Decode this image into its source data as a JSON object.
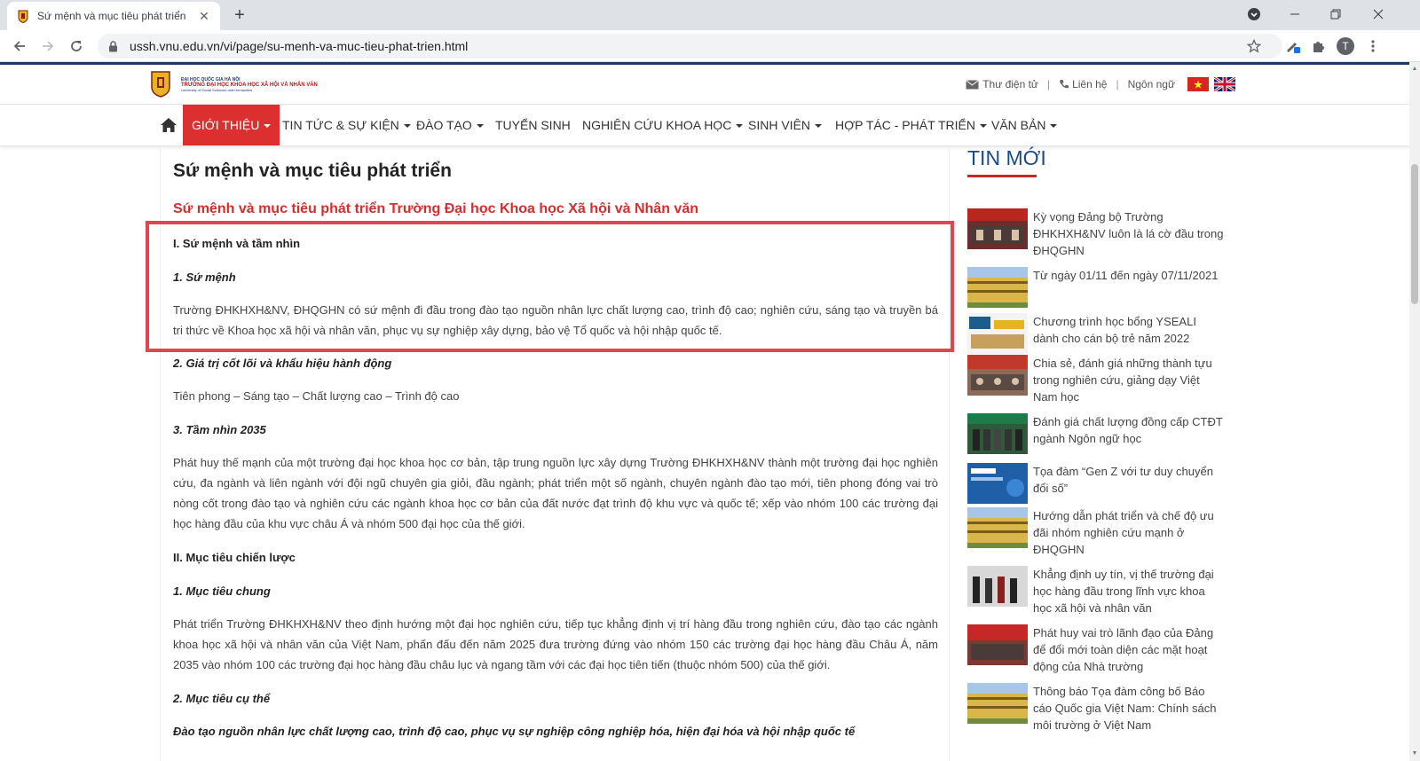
{
  "browser": {
    "tab_title": "Sứ mệnh và mục tiêu phát triển",
    "tab_close": "✕",
    "new_tab": "+",
    "url": "ussh.vnu.edu.vn/vi/page/su-menh-va-muc-tieu-phat-trien.html",
    "profile_initial": "T"
  },
  "site": {
    "logo_line1": "ĐẠI HỌC QUỐC GIA HÀ NỘI",
    "logo_line2": "TRƯỜNG ĐẠI HỌC KHOA HỌC XÃ HỘI VÀ NHÂN VĂN",
    "logo_line3": "University of Social Sciences and Humanities",
    "top_links": {
      "email": "Thư điện tử",
      "contact": "Liên hệ",
      "language": "Ngôn ngữ",
      "separator": "|"
    }
  },
  "nav": {
    "items": [
      {
        "label": "GIỚI THIỆU",
        "active": true
      },
      {
        "label": "TIN TỨC & SỰ KIỆN"
      },
      {
        "label": "ĐÀO TẠO"
      },
      {
        "label": "TUYỂN SINH"
      },
      {
        "label": "NGHIÊN CỨU KHOA HỌC"
      },
      {
        "label": "SINH VIÊN"
      },
      {
        "label": "HỢP TÁC - PHÁT TRIỂN"
      },
      {
        "label": "VĂN BẢN"
      }
    ]
  },
  "content": {
    "title": "Sứ mệnh và mục tiêu phát triển",
    "subtitle": "Sứ mệnh và mục tiêu phát triển Trường Đại học Khoa học Xã hội và Nhân văn",
    "s1_heading": "I. Sứ mệnh và tầm nhìn",
    "s1_1_heading": "1. Sứ mệnh",
    "s1_1_text": "Trường ĐHKHXH&NV, ĐHQGHN có sứ mệnh đi đầu trong đào tạo nguồn nhân lực chất lượng cao, trình độ cao; nghiên cứu, sáng tạo và truyền bá tri thức về Khoa học xã hội và nhân văn, phục vụ sự nghiệp xây dựng, bảo vệ Tổ quốc và hội nhập quốc tế.",
    "s1_2_heading": "2. Giá trị cốt lõi và khẩu hiệu hành động",
    "s1_2_text": "Tiên phong – Sáng tạo – Chất lượng cao – Trình độ cao",
    "s1_3_heading": "3. Tầm nhìn 2035",
    "s1_3_text": "Phát huy thế mạnh của một trường đại học khoa học cơ bản, tập trung nguồn lực xây dựng Trường ĐHKHXH&NV thành một trường đại học nghiên cứu, đa ngành và liên ngành với đội ngũ chuyên gia giỏi, đầu ngành; phát triển một số ngành, chuyên ngành đào tạo mới, tiên phong đóng vai trò nòng cốt trong đào tạo và nghiên cứu các ngành khoa học cơ bản của đất nước đạt trình độ khu vực và quốc tế; xếp vào nhóm 100 các trường đại học hàng đầu của khu vực châu Á và nhóm 500 đại học của thế giới.",
    "s2_heading": "II. Mục tiêu chiến lược",
    "s2_1_heading": "1. Mục tiêu chung",
    "s2_1_text": "Phát triển Trường ĐHKHXH&NV theo định hướng một đại học nghiên cứu, tiếp tục khẳng định vị trí hàng đầu trong nghiên cứu, đào tạo các ngành khoa học xã hội và nhân văn của Việt Nam, phấn đấu đến năm 2025 đưa trường đứng vào nhóm 150 các trường đại học hàng đầu Châu Á, năm 2035 vào nhóm 100 các trường đại học hàng đầu châu lục và ngang tầm với các đại học tiên tiến (thuộc nhóm 500) của thế giới.",
    "s2_2_heading": "2. Mục tiêu cụ thể",
    "s2_2_text": "Đào tạo nguồn nhân lực chất lượng cao, trình độ cao, phục vụ sự nghiệp công nghiệp hóa, hiện đại hóa và hội nhập quốc tế"
  },
  "sidebar": {
    "title": "TIN MỚI",
    "news": [
      {
        "text": "Kỳ vọng Đảng bộ Trường ĐHKHXH&NV luôn là lá cờ đầu trong ĐHQGHN"
      },
      {
        "text": "Từ ngày 01/11 đến ngày 07/11/2021"
      },
      {
        "text": "Chương trình học bổng YSEALI dành cho cán bộ trẻ năm 2022"
      },
      {
        "text": "Chia sẻ, đánh giá những thành tựu trong nghiên cứu, giảng dạy Việt Nam học"
      },
      {
        "text": "Đánh giá chất lượng đồng cấp CTĐT ngành Ngôn ngữ học"
      },
      {
        "text": "Tọa đàm “Gen Z với tư duy chuyển đổi số”"
      },
      {
        "text": "Hướng dẫn phát triển và chế độ ưu đãi nhóm nghiên cứu mạnh ở ĐHQGHN"
      },
      {
        "text": "Khẳng định uy tín, vị thế trường đại học hàng đầu trong lĩnh vực khoa học xã hội và nhân văn"
      },
      {
        "text": "Phát huy vai trò lãnh đạo của Đảng để đổi mới toàn diện các mặt hoạt động của Nhà trường"
      },
      {
        "text": "Thông báo Tọa đàm công bố Báo cáo Quốc gia Việt Nam: Chính sách môi trường ở Việt Nam"
      }
    ]
  },
  "colors": {
    "accent_red": "#dc2f2f",
    "brand_blue": "#1b4a8c",
    "highlight_box": "#e0474c"
  }
}
